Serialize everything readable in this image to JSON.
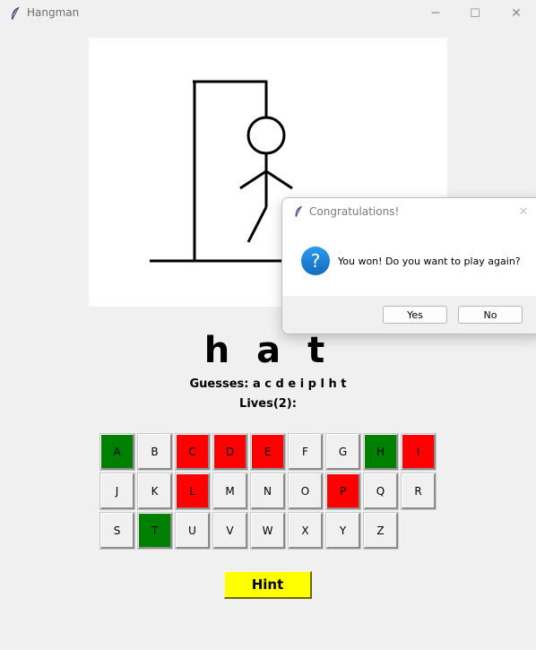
{
  "window": {
    "title": "Hangman",
    "controls": {
      "minimize": "─",
      "maximize": "☐",
      "close": "✕"
    }
  },
  "game": {
    "word": "h a t",
    "guesses_text": "Guesses: a c d e i p l h t",
    "lives_text": "Lives(2):"
  },
  "keyboard": {
    "rows": [
      [
        {
          "letter": "A",
          "state": "correct"
        },
        {
          "letter": "B",
          "state": "none"
        },
        {
          "letter": "C",
          "state": "wrong"
        },
        {
          "letter": "D",
          "state": "wrong"
        },
        {
          "letter": "E",
          "state": "wrong"
        },
        {
          "letter": "F",
          "state": "none"
        },
        {
          "letter": "G",
          "state": "none"
        },
        {
          "letter": "H",
          "state": "correct"
        },
        {
          "letter": "I",
          "state": "wrong"
        }
      ],
      [
        {
          "letter": "J",
          "state": "none"
        },
        {
          "letter": "K",
          "state": "none"
        },
        {
          "letter": "L",
          "state": "wrong"
        },
        {
          "letter": "M",
          "state": "none"
        },
        {
          "letter": "N",
          "state": "none"
        },
        {
          "letter": "O",
          "state": "none"
        },
        {
          "letter": "P",
          "state": "wrong"
        },
        {
          "letter": "Q",
          "state": "none"
        },
        {
          "letter": "R",
          "state": "none"
        }
      ],
      [
        {
          "letter": "S",
          "state": "none"
        },
        {
          "letter": "T",
          "state": "correct"
        },
        {
          "letter": "U",
          "state": "none"
        },
        {
          "letter": "V",
          "state": "none"
        },
        {
          "letter": "W",
          "state": "none"
        },
        {
          "letter": "X",
          "state": "none"
        },
        {
          "letter": "Y",
          "state": "none"
        },
        {
          "letter": "Z",
          "state": "none"
        }
      ]
    ]
  },
  "hint_button": {
    "label": "Hint",
    "color": "#ffff00"
  },
  "dialog": {
    "title": "Congratulations!",
    "icon": "question-icon",
    "message": "You won! Do you want to play again?",
    "yes_label": "Yes",
    "no_label": "No",
    "close": "✕"
  },
  "colors": {
    "correct": "#008000",
    "wrong": "#ff0000",
    "background": "#f0f0f0",
    "dialog_accent": "#1a7fd6"
  }
}
